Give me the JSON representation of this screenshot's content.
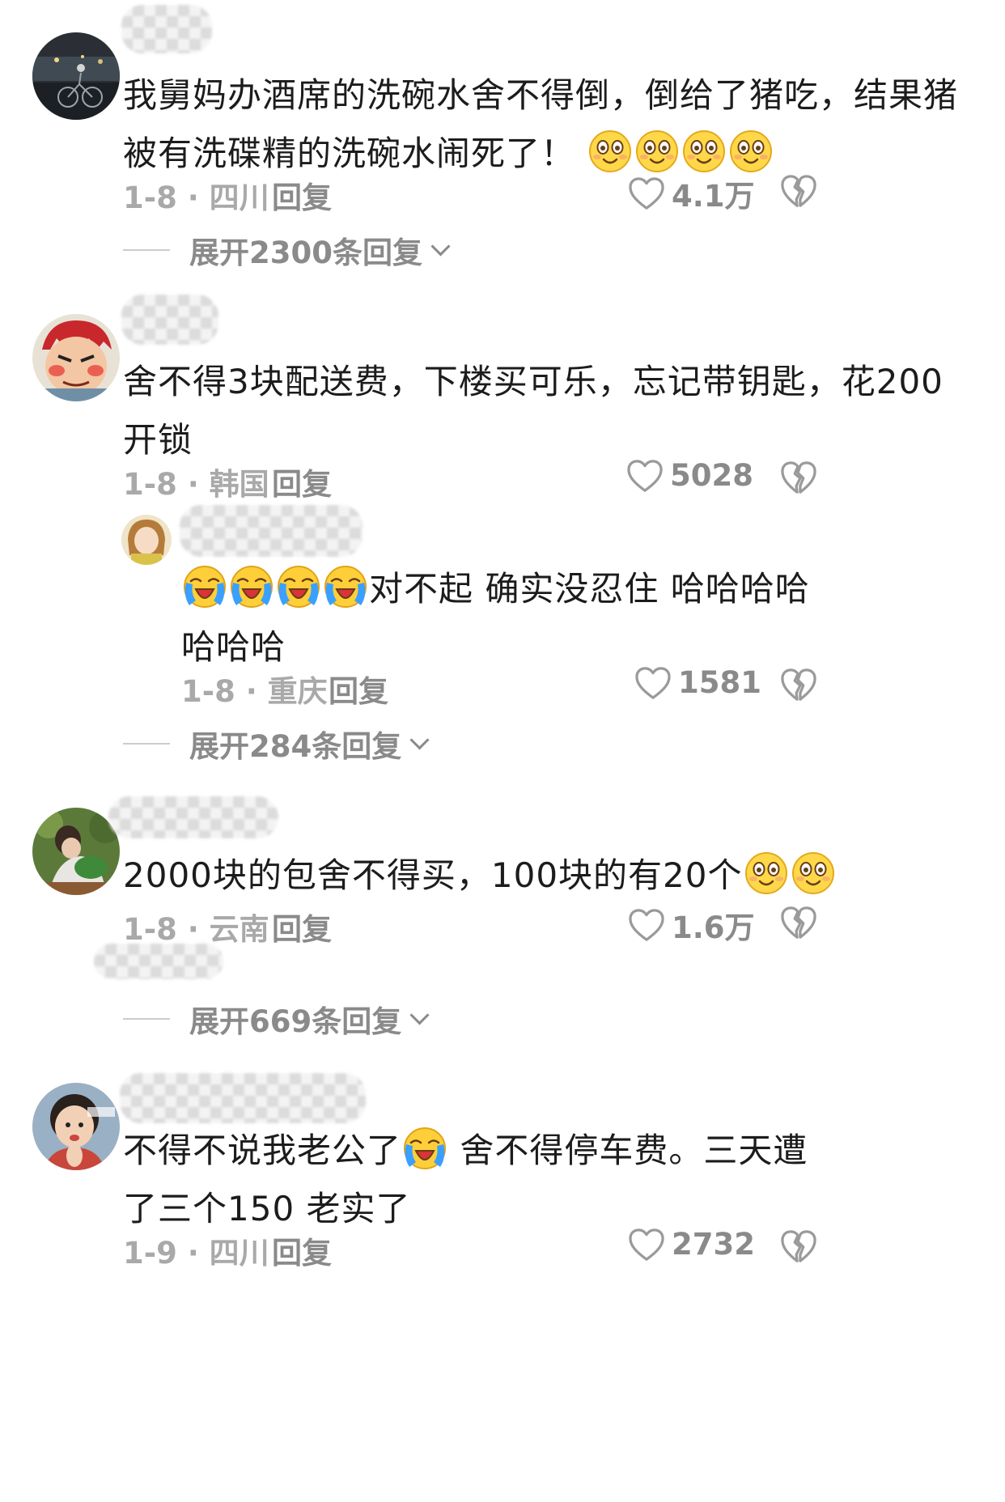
{
  "comments": [
    {
      "text": "我舅妈办酒席的洗碗水舍不得倒，倒给了猪吃，结果猪被有洗碟精的洗碗水闹死了！",
      "emojis": [
        "smile-emoji",
        "smile-emoji",
        "smile-emoji",
        "smile-emoji"
      ],
      "date_loc": "1-8 · 四川",
      "reply_label": "回复",
      "likes": "4.1万",
      "expand_label": "展开2300条回复"
    },
    {
      "text": "舍不得3块配送费，下楼买可乐，忘记带钥匙，花200开锁",
      "date_loc": "1-8 · 韩国",
      "reply_label": "回复",
      "likes": "5028",
      "subreply": {
        "emojis": [
          "crying-emoji",
          "crying-emoji",
          "crying-emoji",
          "crying-emoji"
        ],
        "text": "对不起 确实没忍住 哈哈哈哈哈哈哈",
        "date_loc": "1-8 · 重庆",
        "reply_label": "回复",
        "likes": "1581"
      },
      "expand_label": "展开284条回复"
    },
    {
      "text": "2000块的包舍不得买，100块的有20个",
      "emojis": [
        "smile-emoji",
        "smile-emoji"
      ],
      "date_loc": "1-8 · 云南",
      "reply_label": "回复",
      "likes": "1.6万",
      "expand_label": "展开669条回复"
    },
    {
      "text_before": "不得不说我老公了",
      "emoji": "crying-emoji",
      "text_after": " 舍不得停车费。三天遭了三个150 老实了",
      "date_loc": "1-9 · 四川",
      "reply_label": "回复",
      "likes": "2732"
    }
  ],
  "colors": {
    "text": "#1c1c1c",
    "meta": "#a9a9a9",
    "secondary": "#8a8a8a"
  }
}
